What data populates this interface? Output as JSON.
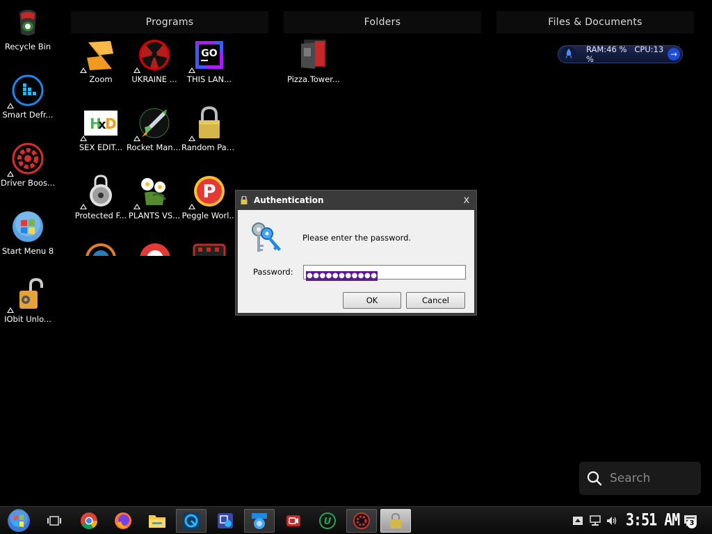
{
  "desktop_icons": [
    {
      "label": "Recycle Bin",
      "icon": "recycle-bin-icon"
    },
    {
      "label": "Smart Defr...",
      "icon": "smart-defrag-icon"
    },
    {
      "label": "Driver Boos...",
      "icon": "driver-booster-icon"
    },
    {
      "label": "Start Menu 8",
      "icon": "start-menu-8-icon"
    },
    {
      "label": "IObit Unlo...",
      "icon": "iobit-unlocker-icon"
    }
  ],
  "fences": {
    "programs": {
      "title": "Programs",
      "items": [
        {
          "label": "Zoom",
          "icon": "zoom-app-icon"
        },
        {
          "label": "UKRAINE ...",
          "icon": "radiation-icon"
        },
        {
          "label": "THIS LAN...",
          "icon": "goland-icon"
        },
        {
          "label": "SEX EDIT...",
          "icon": "hxd-editor-icon"
        },
        {
          "label": "Rocket Mani...",
          "icon": "rocket-icon"
        },
        {
          "label": "Random Pass...",
          "icon": "padlock-icon"
        },
        {
          "label": "Protected F...",
          "icon": "protected-folder-icon"
        },
        {
          "label": "PLANTS VS...",
          "icon": "plants-vs-zombies-icon"
        },
        {
          "label": "Peggle Worl...",
          "icon": "peggle-icon"
        }
      ]
    },
    "folders": {
      "title": "Folders",
      "items": [
        {
          "label": "Pizza.Tower...",
          "icon": "pizza-tower-icon"
        }
      ]
    },
    "files": {
      "title": "Files & Documents"
    }
  },
  "sysmon": {
    "ram_label": "RAM:46 %",
    "cpu_label": "CPU:13 %"
  },
  "dialog": {
    "title": "Authentication",
    "prompt": "Please enter the password.",
    "password_label": "Password:",
    "password_mask": "●●●●●●●●●●●",
    "ok_label": "OK",
    "cancel_label": "Cancel",
    "close_glyph": "x"
  },
  "search": {
    "placeholder": "Search"
  },
  "taskbar": {
    "clock": "3:51 AM",
    "notification_count": "3",
    "apps": [
      "start-orb-icon",
      "task-view-icon",
      "chrome-icon",
      "firefox-icon",
      "file-explorer-icon",
      "advanced-systemcare-icon",
      "image-app-icon",
      "network-app-icon",
      "screen-recorder-icon",
      "uninstaller-icon",
      "driver-booster-taskbar-icon",
      "lock-app-icon"
    ]
  },
  "colors": {
    "accent_purple": "#5b1b8c",
    "sysmon_blue": "#1e4bd8"
  }
}
